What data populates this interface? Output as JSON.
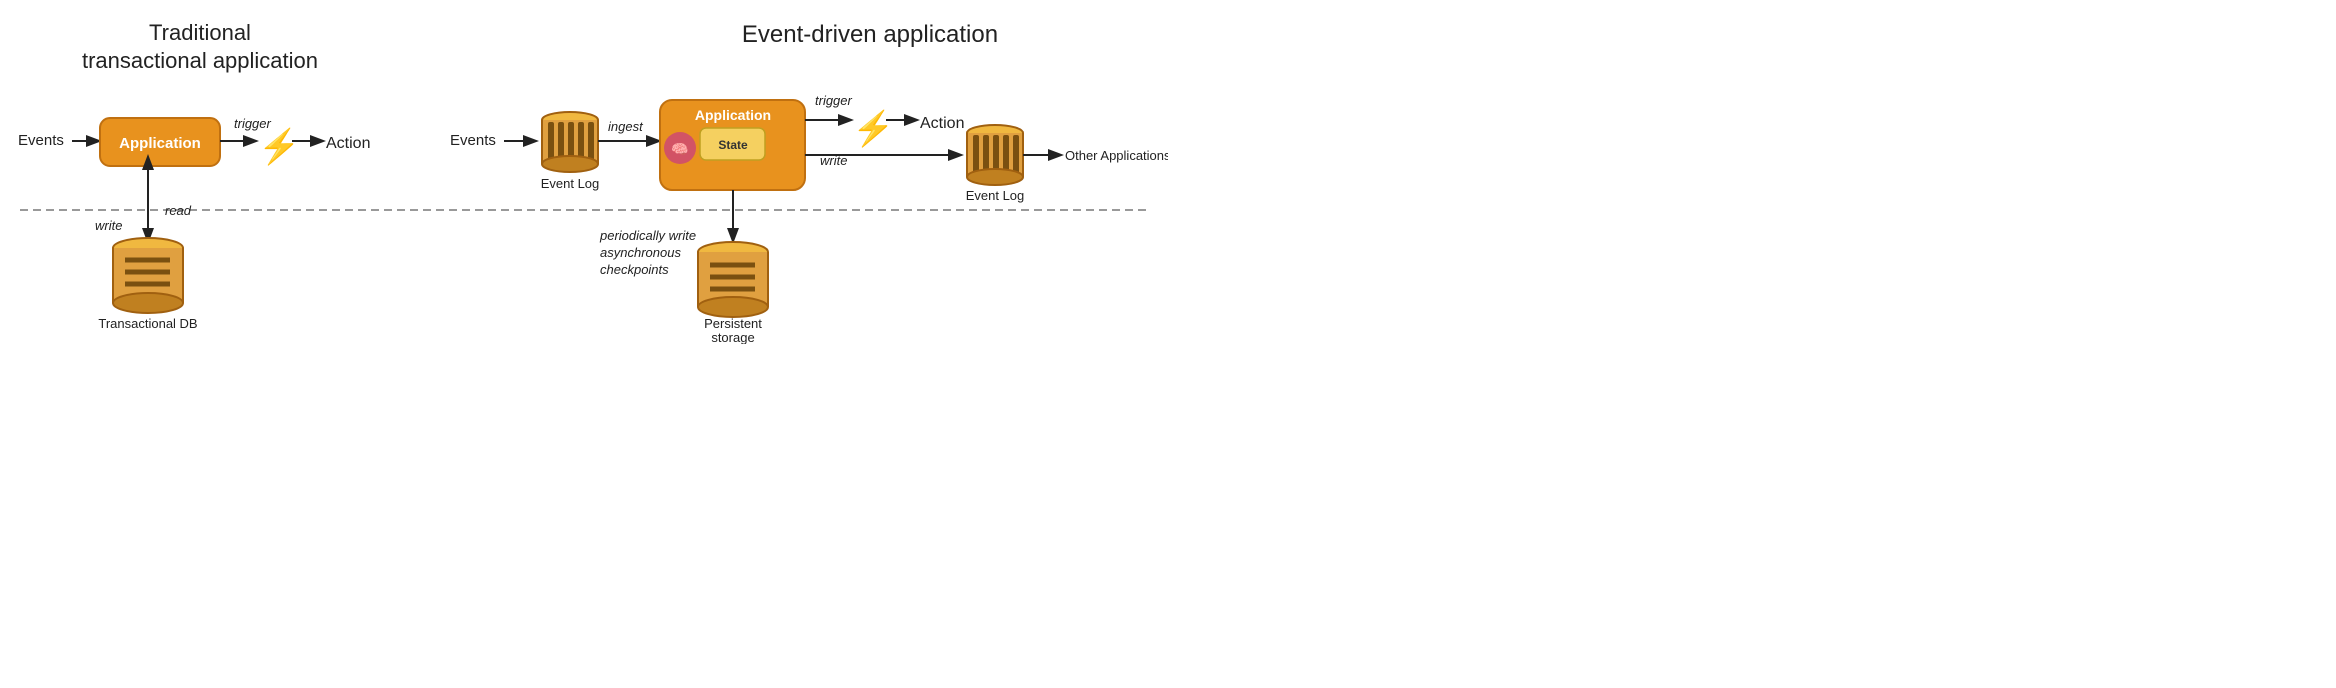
{
  "left": {
    "title": "Traditional\ntransactional application",
    "events_label": "Events",
    "application_label": "Application",
    "action_label": "Action",
    "trigger_label": "trigger",
    "write_label": "write",
    "read_label": "read",
    "db_label": "Transactional DB"
  },
  "right": {
    "title": "Event-driven application",
    "events_label": "Events",
    "event_log_label": "Event Log",
    "application_label": "Application",
    "state_label": "State",
    "ingest_label": "ingest",
    "trigger_label": "trigger",
    "action_label": "Action",
    "write_label": "write",
    "other_apps_label": "Other Applications",
    "event_log2_label": "Event Log",
    "checkpoint_label": "periodically write\nasynchronous\ncheckpoints",
    "persistent_label": "Persistent\nstorage"
  },
  "colors": {
    "orange": "#E8921E",
    "orange_dark": "#C07010",
    "gray": "#888888",
    "text": "#222222"
  }
}
